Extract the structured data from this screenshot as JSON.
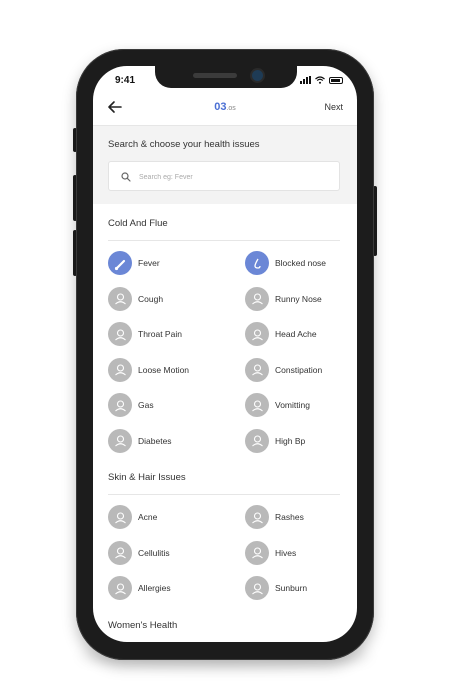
{
  "status_bar": {
    "time": "9:41"
  },
  "navbar": {
    "step_current": "03",
    "step_suffix": ".os",
    "next_label": "Next"
  },
  "search": {
    "title": "Search & choose your health issues",
    "placeholder": "Search eg: Fever"
  },
  "sections": [
    {
      "title": "Cold And Flue",
      "items": [
        {
          "label": "Fever",
          "icon": "thermometer-icon",
          "selected": true
        },
        {
          "label": "Blocked nose",
          "icon": "nose-icon",
          "selected": true
        },
        {
          "label": "Cough",
          "icon": "cough-icon",
          "selected": false
        },
        {
          "label": "Runny Nose",
          "icon": "runny-nose-icon",
          "selected": false
        },
        {
          "label": "Throat Pain",
          "icon": "throat-icon",
          "selected": false
        },
        {
          "label": "Head Ache",
          "icon": "head-icon",
          "selected": false
        },
        {
          "label": "Loose Motion",
          "icon": "stomach-icon",
          "selected": false
        },
        {
          "label": "Constipation",
          "icon": "constipation-icon",
          "selected": false
        },
        {
          "label": "Gas",
          "icon": "gas-icon",
          "selected": false
        },
        {
          "label": "Vomitting",
          "icon": "vomit-icon",
          "selected": false
        },
        {
          "label": "Diabetes",
          "icon": "diabetes-icon",
          "selected": false
        },
        {
          "label": "High Bp",
          "icon": "blood-pressure-icon",
          "selected": false
        }
      ]
    },
    {
      "title": "Skin & Hair Issues",
      "items": [
        {
          "label": "Acne",
          "icon": "acne-icon",
          "selected": false
        },
        {
          "label": "Rashes",
          "icon": "rashes-icon",
          "selected": false
        },
        {
          "label": "Cellulitis",
          "icon": "cellulitis-icon",
          "selected": false
        },
        {
          "label": "Hives",
          "icon": "hives-icon",
          "selected": false
        },
        {
          "label": "Allergies",
          "icon": "allergies-icon",
          "selected": false
        },
        {
          "label": "Sunburn",
          "icon": "sunburn-icon",
          "selected": false
        }
      ]
    },
    {
      "title": "Women's Health",
      "items": []
    }
  ],
  "colors": {
    "accent": "#4a6fd4",
    "selected_icon_bg": "#6b87d6",
    "unselected_icon_bg": "#b9b9b9",
    "search_section_bg": "#f3f3f3"
  }
}
